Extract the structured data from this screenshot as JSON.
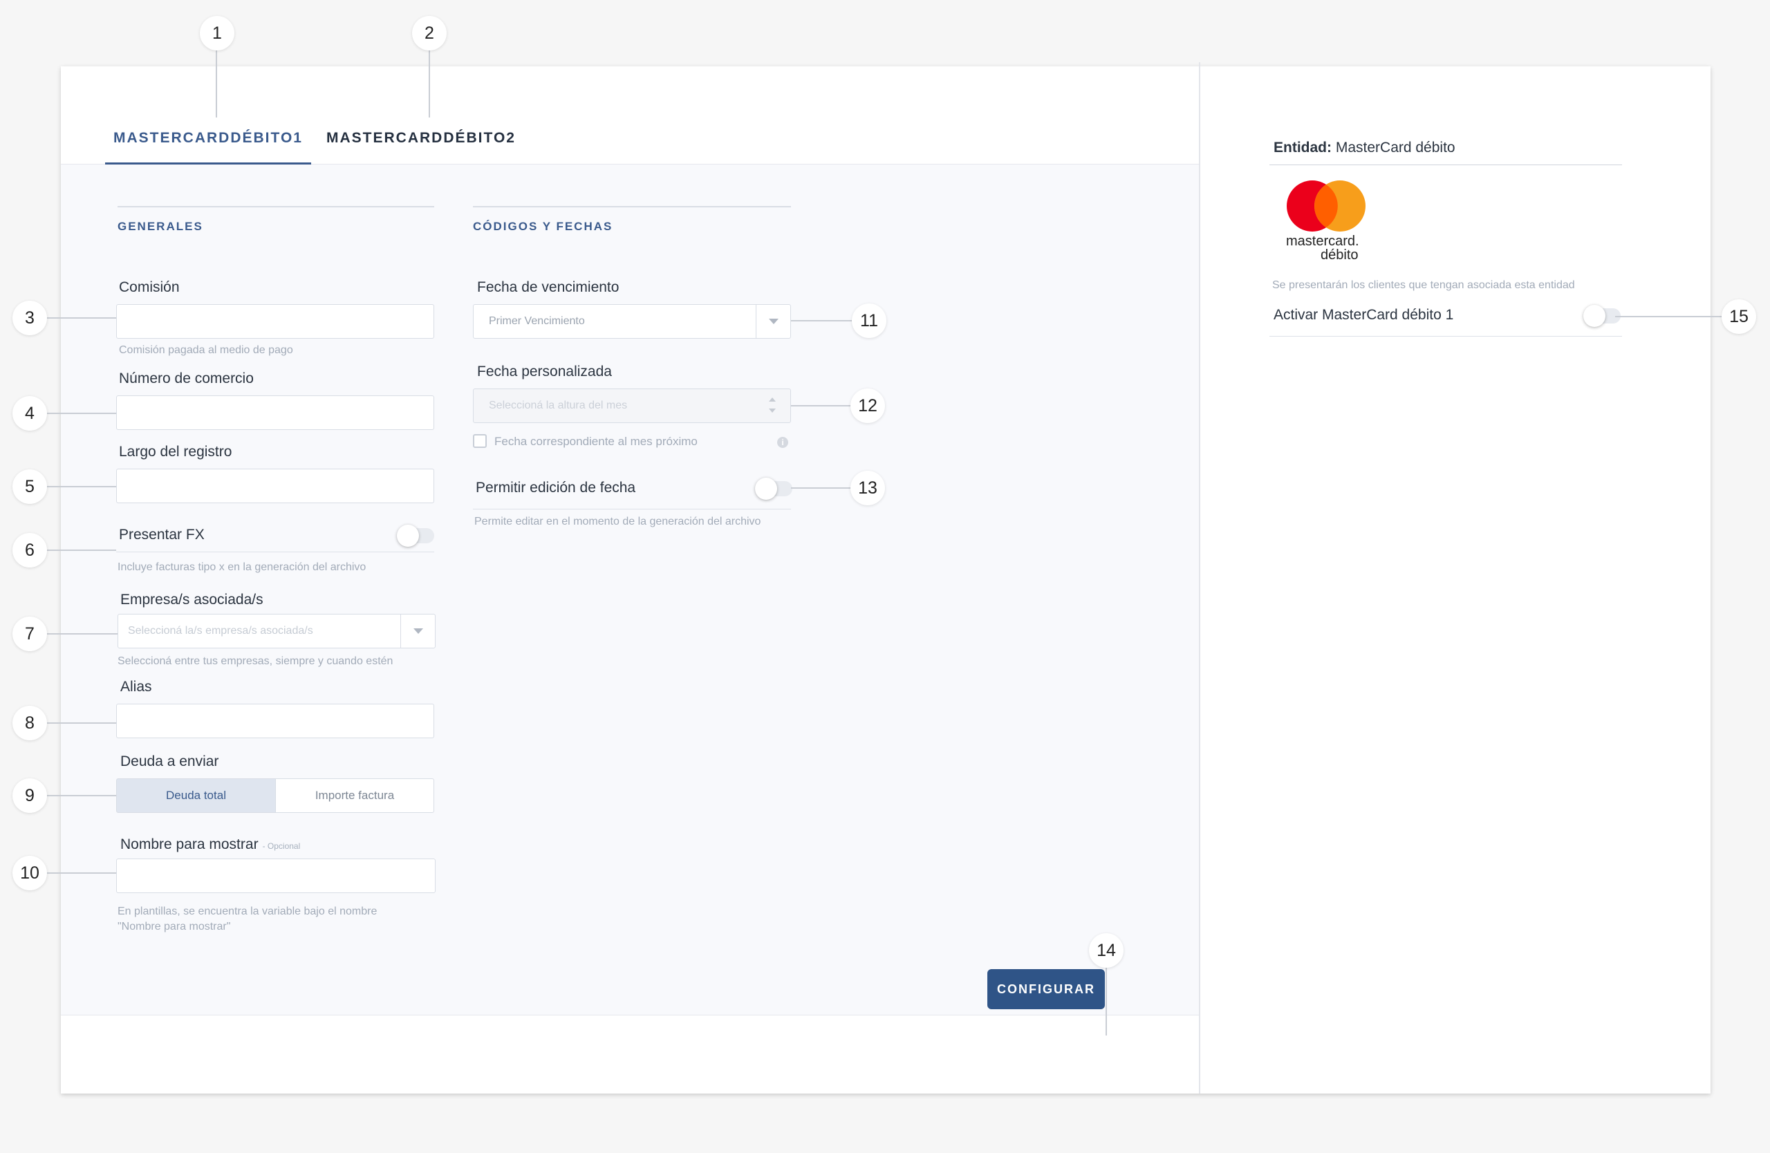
{
  "tabs": [
    {
      "label": "MASTERCARDDÉBITO1",
      "active": true
    },
    {
      "label": "MASTERCARDDÉBITO2",
      "active": false
    }
  ],
  "sections": {
    "generales": "GENERALES",
    "codigos": "CÓDIGOS Y FECHAS"
  },
  "fields": {
    "comision": {
      "label": "Comisión",
      "hint": "Comisión pagada al medio de pago",
      "value": ""
    },
    "numero_comercio": {
      "label": "Número de comercio",
      "value": ""
    },
    "largo_registro": {
      "label": "Largo del registro",
      "value": ""
    },
    "presentar_fx": {
      "label": "Presentar FX",
      "hint": "Incluye facturas tipo x en la generación del archivo",
      "on": false
    },
    "empresas": {
      "label": "Empresa/s asociada/s",
      "placeholder": "Seleccioná la/s empresa/s asociada/s",
      "hint": "Seleccioná entre tus empresas, siempre y cuando estén"
    },
    "alias": {
      "label": "Alias",
      "value": ""
    },
    "deuda": {
      "label": "Deuda a enviar",
      "options": [
        "Deuda total",
        "Importe factura"
      ],
      "selected": "Deuda total"
    },
    "nombre_mostrar": {
      "label": "Nombre para mostrar",
      "optional": "- Opcional",
      "hint_line1": "En plantillas, se encuentra la variable bajo el nombre",
      "hint_line2": "\"Nombre para mostrar\"",
      "value": ""
    },
    "fecha_vencimiento": {
      "label": "Fecha de vencimiento",
      "selected": "Primer Vencimiento"
    },
    "fecha_personalizada": {
      "label": "Fecha personalizada",
      "placeholder": "Seleccioná la altura del mes"
    },
    "fecha_mes_proximo": {
      "label": "Fecha correspondiente al mes próximo",
      "checked": false
    },
    "permitir_edicion": {
      "label": "Permitir edición de fecha",
      "hint": "Permite editar en el momento de la generación del archivo",
      "on": false
    }
  },
  "footer": {
    "configurar": "CONFIGURAR"
  },
  "entity": {
    "title_bold": "Entidad:",
    "title_value": "MasterCard débito",
    "logo_text_1": "mastercard.",
    "logo_text_2": "débito",
    "note": "Se presentarán los clientes que tengan asociada esta entidad",
    "activar_label": "Activar MasterCard débito 1",
    "activar_on": false
  },
  "callouts": [
    "1",
    "2",
    "3",
    "4",
    "5",
    "6",
    "7",
    "8",
    "9",
    "10",
    "11",
    "12",
    "13",
    "14",
    "15"
  ],
  "colors": {
    "accent": "#2f5487",
    "mastercard_red": "#eb001b",
    "mastercard_orange": "#f79e1b",
    "mastercard_overlap": "#ff5f00"
  }
}
